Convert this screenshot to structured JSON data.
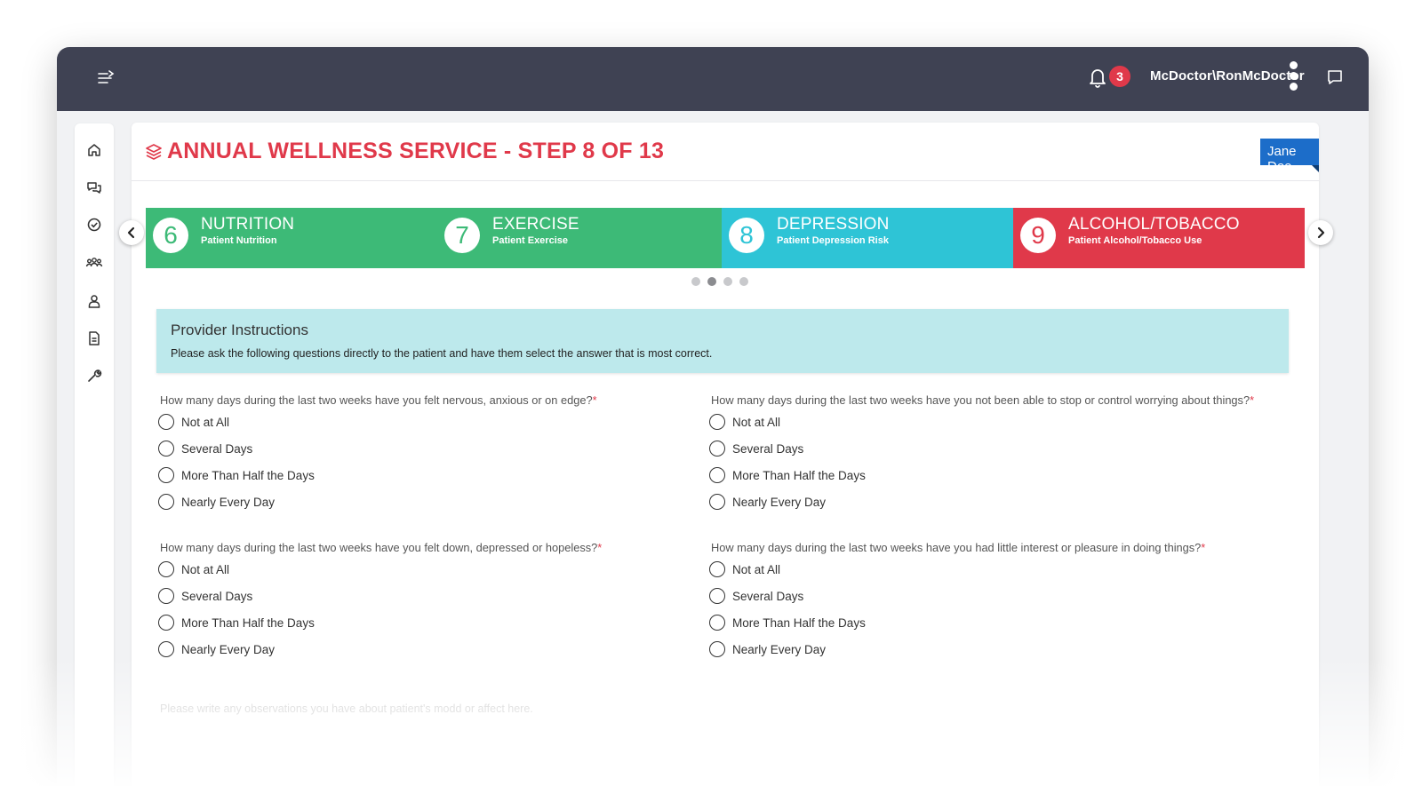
{
  "header": {
    "username": "McDoctor\\RonMcDoctor",
    "notification_count": "3"
  },
  "sidebar": {
    "items": [
      "home-icon",
      "chat-bubbles-icon",
      "check-circle-icon",
      "users-group-icon",
      "user-settings-icon",
      "document-icon",
      "wrench-icon"
    ]
  },
  "page": {
    "title": "ANNUAL WELLNESS SERVICE - STEP 8 OF 13",
    "patient_name": "Jane Doe"
  },
  "steps": [
    {
      "num": "6",
      "title": "NUTRITION",
      "subtitle": "Patient Nutrition",
      "color": "#3dba77"
    },
    {
      "num": "7",
      "title": "EXERCISE",
      "subtitle": "Patient Exercise",
      "color": "#3dba77"
    },
    {
      "num": "8",
      "title": "DEPRESSION",
      "subtitle": "Patient Depression Risk",
      "color": "#2ec4d6"
    },
    {
      "num": "9",
      "title": "ALCOHOL/TOBACCO",
      "subtitle": "Patient Alcohol/Tobacco Use",
      "color": "#e0394a"
    }
  ],
  "carousel": {
    "dot_count": 4,
    "active_dot": 2
  },
  "instructions": {
    "title": "Provider Instructions",
    "text": "Please ask the following questions directly to the patient and have them select the answer that is most correct."
  },
  "questions": [
    {
      "text": "How many days during the last two weeks have you felt nervous, anxious or on edge?",
      "options": [
        "Not at All",
        "Several Days",
        "More Than Half the Days",
        "Nearly Every Day"
      ]
    },
    {
      "text": "How many days during the last two weeks have you not been able to stop or control worrying about things?",
      "options": [
        "Not at All",
        "Several Days",
        "More Than Half the Days",
        "Nearly Every Day"
      ]
    },
    {
      "text": "How many days during the last two weeks have you felt down, depressed or hopeless?",
      "options": [
        "Not at All",
        "Several Days",
        "More Than Half the Days",
        "Nearly Every Day"
      ]
    },
    {
      "text": "How many days during the last two weeks have you had little interest or pleasure in doing things?",
      "options": [
        "Not at All",
        "Several Days",
        "More Than Half the Days",
        "Nearly Every Day"
      ]
    }
  ],
  "required_mark": "*",
  "observations": {
    "placeholder": "Please write any observations you have about patient's modd or affect here."
  },
  "colors": {
    "topbar": "#3f4253",
    "accent_red": "#e0394a",
    "patient_tag": "#1c6dc9",
    "instructions_bg": "#bde9ec"
  }
}
